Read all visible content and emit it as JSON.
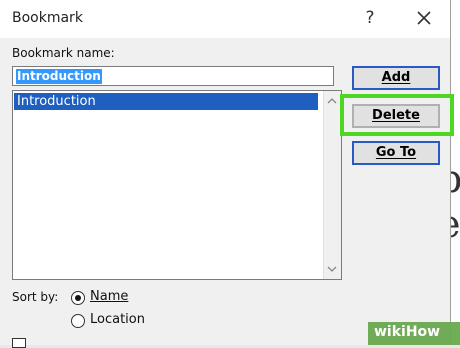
{
  "window": {
    "title": "Bookmark",
    "help_label": "?",
    "close_icon": "close-icon"
  },
  "bookmark_name": {
    "label": "Bookmark name:",
    "value": "Introduction"
  },
  "list": {
    "items": [
      "Introduction"
    ],
    "selected_index": 0
  },
  "buttons": {
    "add": "Add",
    "delete": "Delete",
    "goto": "Go To"
  },
  "sort": {
    "label": "Sort by:",
    "options": [
      "Name",
      "Location"
    ],
    "selected": "Name"
  },
  "colors": {
    "highlight": "#4dd622",
    "selection": "#1e5fbf",
    "button_border": "#2b59c3"
  },
  "watermark": {
    "text": "wikiHow"
  }
}
